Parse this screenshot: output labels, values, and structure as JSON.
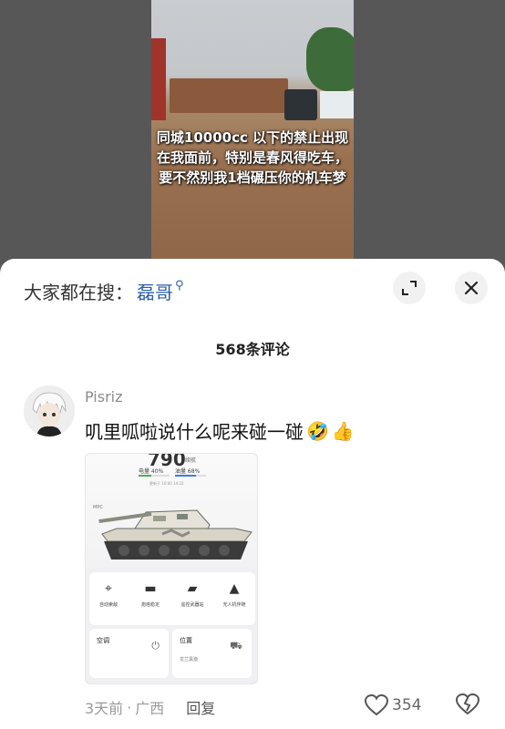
{
  "video": {
    "caption": "同城10000cc 以下的禁止出现在我面前，特别是春风得吃车，要不然别我1档碾压你的机车梦"
  },
  "search": {
    "prefix": "大家都在搜：",
    "term": "磊哥",
    "icon": "search-icon"
  },
  "comments": {
    "count_label": "568条评论",
    "items": [
      {
        "username": "Pisriz",
        "text": "叽里呱啦说什么呢来碰一碰",
        "emojis": [
          "🤣",
          "👍"
        ],
        "time": "3天前",
        "location": "广西",
        "reply_label": "回复",
        "likes": "354",
        "image": {
          "big_number": "790",
          "big_number_unit": "续航",
          "stat_a": "电量 40%",
          "stat_b": "油量 68%",
          "update_text": "更新于 10:00 14:22",
          "mpc": "MPC",
          "shortcuts": [
            "自动索敌",
            "炮塔稳定",
            "遥控武器站",
            "无人机伴随"
          ],
          "tile_ac": "空调",
          "tile_loc": "位置",
          "tile_loc_sub": "龙兰黑渔"
        }
      }
    ]
  },
  "colors": {
    "accent": "#2d5fa8",
    "muted": "#9a9a9a"
  }
}
